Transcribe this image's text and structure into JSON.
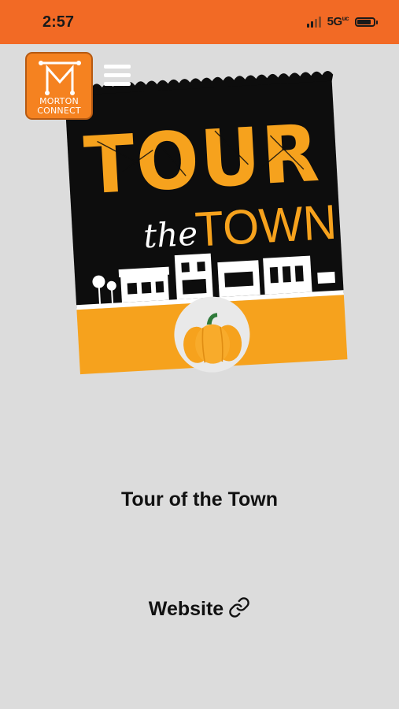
{
  "status_bar": {
    "time": "2:57",
    "network": "5G",
    "network_superscript": "uc"
  },
  "app": {
    "logo_text_top": "MORTON",
    "logo_text_bottom": "CONNECT",
    "logo_icon": "m-logo-icon",
    "menu_icon": "hamburger-menu-icon"
  },
  "poster": {
    "title_line1": "TOUR",
    "title_line2_script": "the",
    "title_line2": "TOWN",
    "colors": {
      "orange": "#f6a21d",
      "black": "#0d0d0d",
      "pumpkin_stem": "#2f7a3a"
    }
  },
  "content": {
    "title": "Tour of the Town",
    "website_label": "Website",
    "link_icon": "link-icon"
  }
}
